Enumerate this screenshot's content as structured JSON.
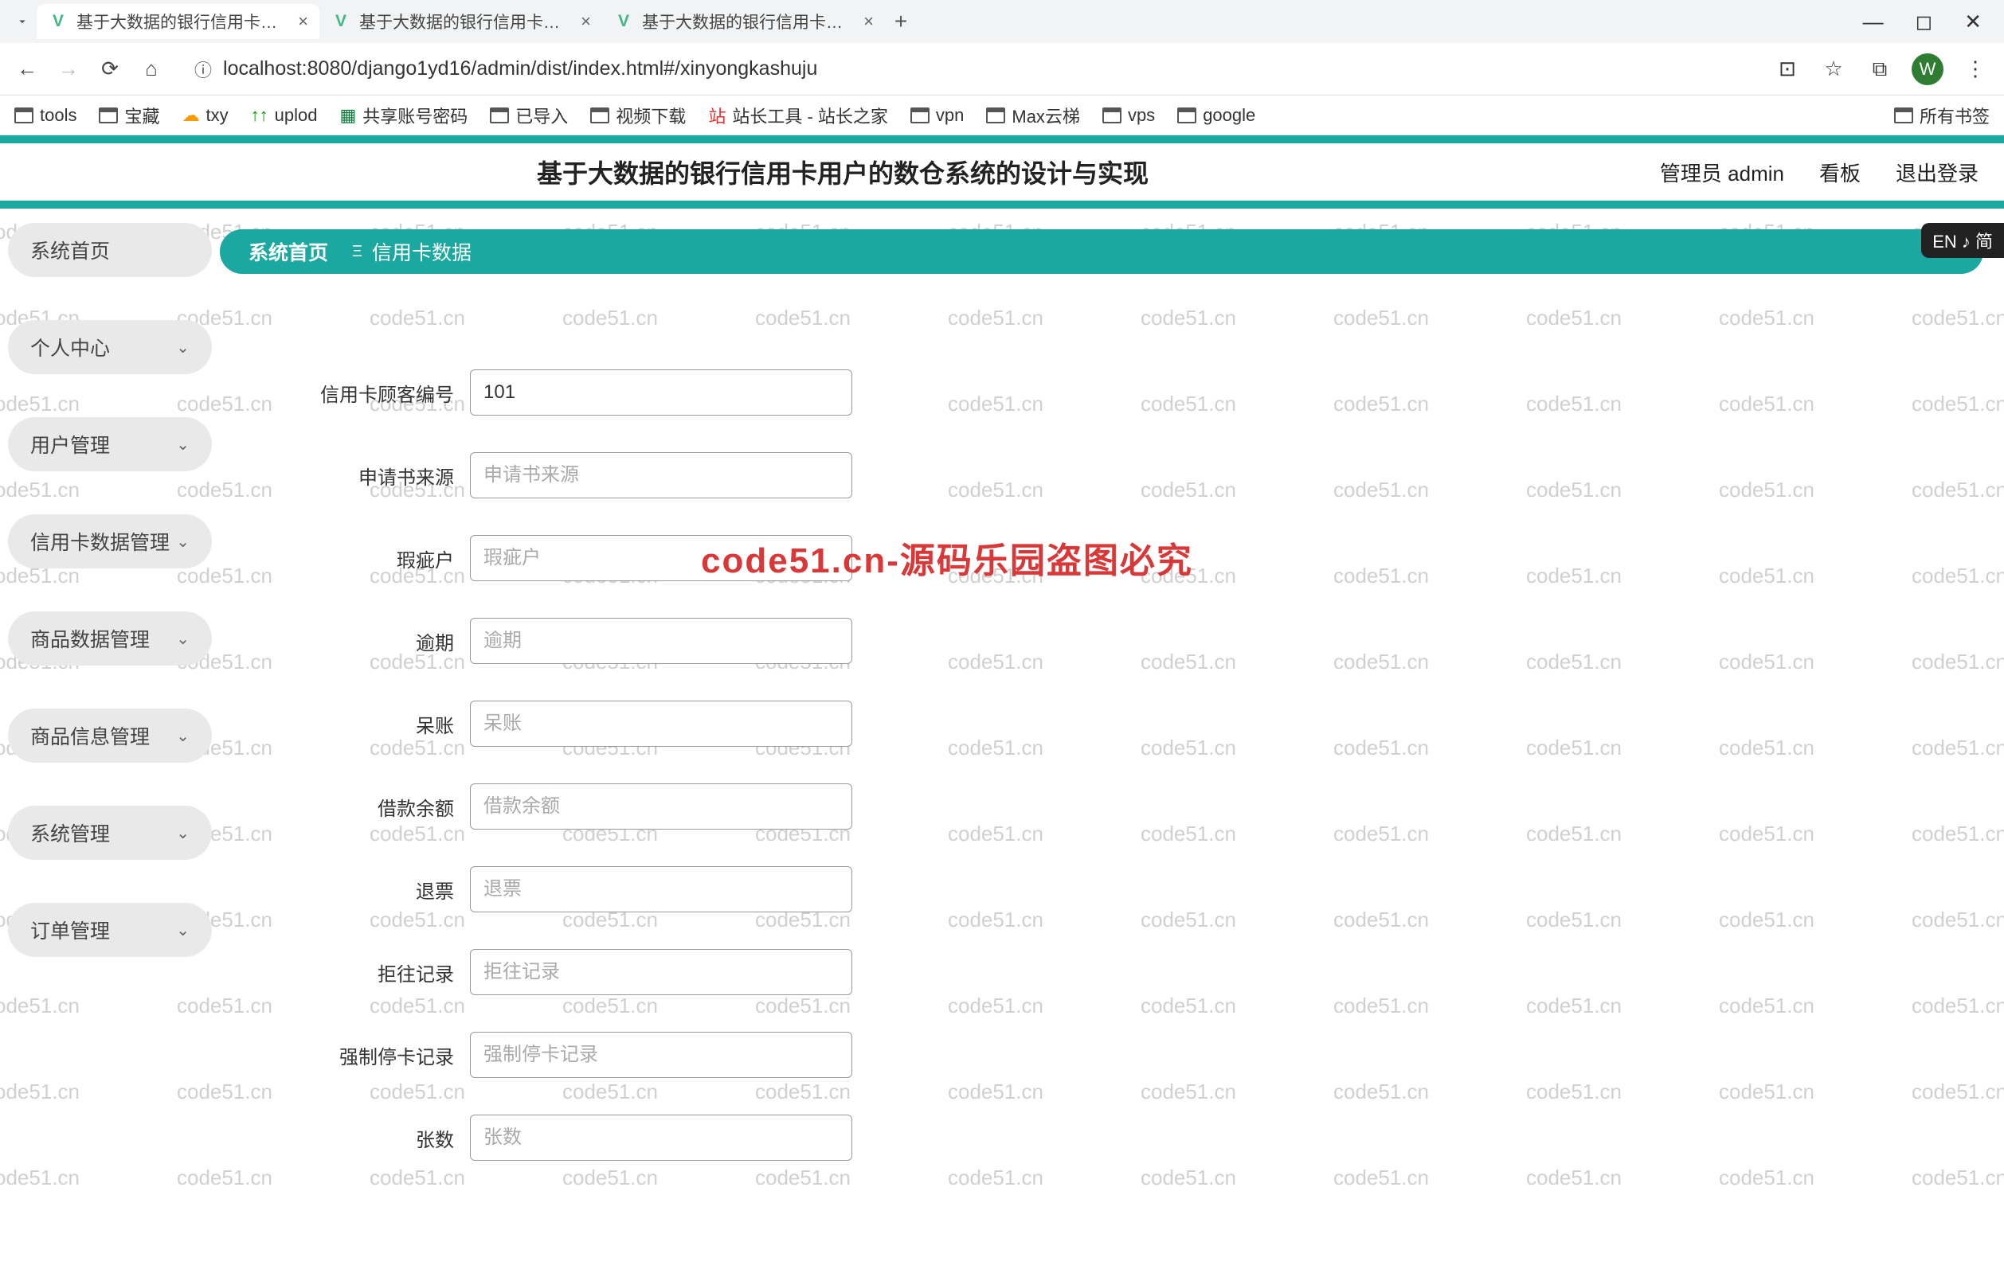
{
  "browser": {
    "tabs": [
      {
        "title": "基于大数据的银行信用卡用户的",
        "active": true
      },
      {
        "title": "基于大数据的银行信用卡用户的",
        "active": false
      },
      {
        "title": "基于大数据的银行信用卡用户的",
        "active": false
      }
    ],
    "url": "localhost:8080/django1yd16/admin/dist/index.html#/xinyongkashuju",
    "avatar_letter": "W"
  },
  "bookmarks": {
    "items": [
      "tools",
      "宝藏",
      "txy",
      "uplod",
      "共享账号密码",
      "已导入",
      "视频下载",
      "站长工具 - 站长之家",
      "vpn",
      "Max云梯",
      "vps",
      "google"
    ],
    "all": "所有书签"
  },
  "header": {
    "title": "基于大数据的银行信用卡用户的数仓系统的设计与实现",
    "admin_label": "管理员 admin",
    "dashboard": "看板",
    "logout": "退出登录"
  },
  "sidebar": {
    "items": [
      {
        "label": "系统首页",
        "expandable": false
      },
      {
        "label": "个人中心",
        "expandable": true
      },
      {
        "label": "用户管理",
        "expandable": true
      },
      {
        "label": "信用卡数据管理",
        "expandable": true
      },
      {
        "label": "商品数据管理",
        "expandable": true
      },
      {
        "label": "商品信息管理",
        "expandable": true
      },
      {
        "label": "系统管理",
        "expandable": true
      },
      {
        "label": "订单管理",
        "expandable": true
      }
    ]
  },
  "breadcrumb": {
    "home": "系统首页",
    "current": "信用卡数据"
  },
  "form": {
    "fields": [
      {
        "label": "信用卡顾客编号",
        "value": "101",
        "placeholder": ""
      },
      {
        "label": "申请书来源",
        "value": "",
        "placeholder": "申请书来源"
      },
      {
        "label": "瑕疵户",
        "value": "",
        "placeholder": "瑕疵户"
      },
      {
        "label": "逾期",
        "value": "",
        "placeholder": "逾期"
      },
      {
        "label": "呆账",
        "value": "",
        "placeholder": "呆账"
      },
      {
        "label": "借款余额",
        "value": "",
        "placeholder": "借款余额"
      },
      {
        "label": "退票",
        "value": "",
        "placeholder": "退票"
      },
      {
        "label": "拒往记录",
        "value": "",
        "placeholder": "拒往记录"
      },
      {
        "label": "强制停卡记录",
        "value": "",
        "placeholder": "强制停卡记录"
      },
      {
        "label": "张数",
        "value": "",
        "placeholder": "张数"
      }
    ]
  },
  "watermark": {
    "text": "code51.cn",
    "big": "code51.cn-源码乐园盗图必究"
  },
  "lang_badge": "EN ♪ 简"
}
